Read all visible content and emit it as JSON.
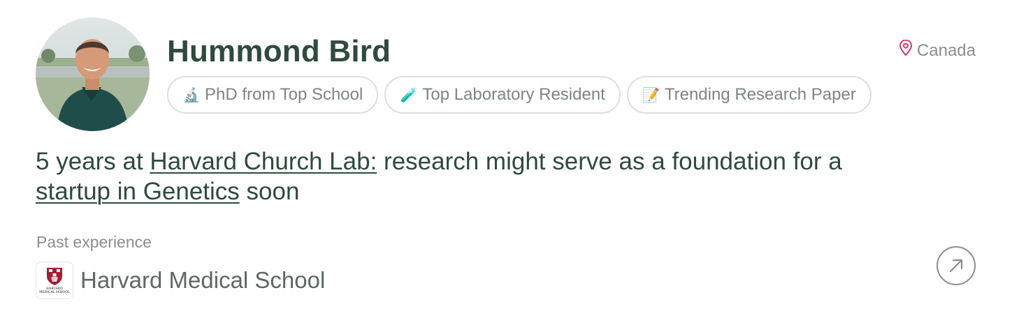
{
  "profile": {
    "name": "Hummond Bird",
    "location": "Canada",
    "badges": [
      {
        "emoji": "🔬",
        "label": "PhD from Top School"
      },
      {
        "emoji": "🧪",
        "label": "Top Laboratory Resident"
      },
      {
        "emoji": "📝",
        "label": "Trending Research Paper"
      }
    ],
    "summary": {
      "prefix": "5 years at ",
      "lab_link": "Harvard Church Lab:",
      "middle": " research might serve as a foundation for a ",
      "startup_link": "startup in Genetics",
      "suffix": " soon"
    },
    "past_experience": {
      "label": "Past experience",
      "items": [
        {
          "name": "Harvard Medical School",
          "logo_text_1": "HARVARD",
          "logo_text_2": "MEDICAL SCHOOL"
        }
      ]
    }
  },
  "colors": {
    "name": "#2f4a3e",
    "muted": "#8a8f8c",
    "pin": "#d6336c",
    "border": "#dcdfdd"
  },
  "icons": {
    "location": "map-pin-icon",
    "open": "arrow-up-right-icon"
  }
}
